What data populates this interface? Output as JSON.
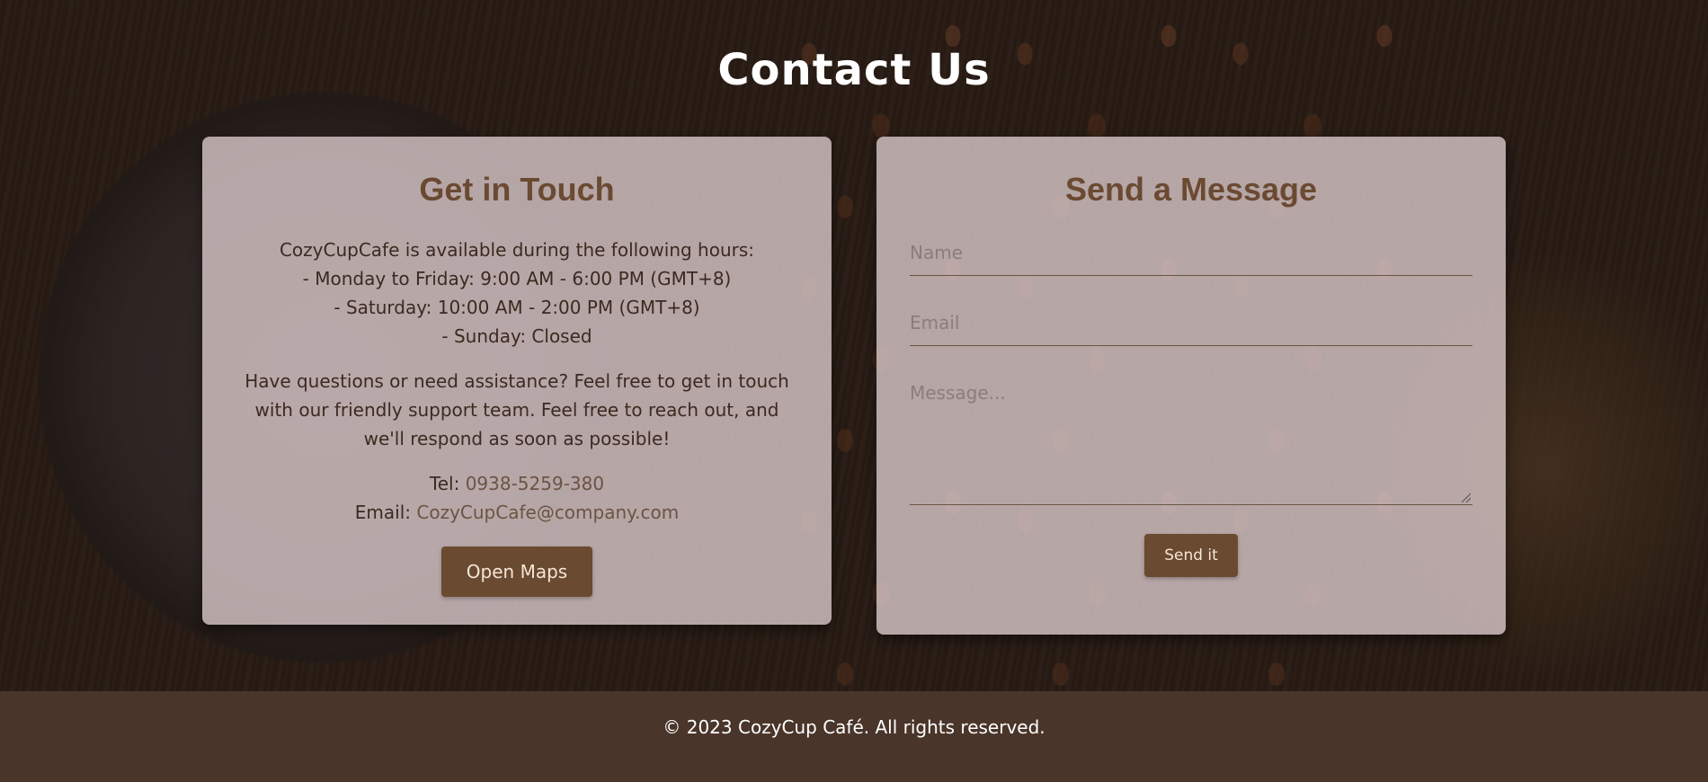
{
  "page_title": "Contact Us",
  "get_in_touch": {
    "heading": "Get in Touch",
    "hours_intro": "CozyCupCafe is available during the following hours:",
    "hours": [
      "- Monday to Friday: 9:00 AM - 6:00 PM (GMT+8)",
      "- Saturday: 10:00 AM - 2:00 PM (GMT+8)",
      "- Sunday: Closed"
    ],
    "about": "Have questions or need assistance? Feel free to get in touch with our friendly support team. Feel free to reach out, and we'll respond as soon as possible!",
    "tel_label": "Tel: ",
    "tel_value": "0938-5259-380",
    "email_label": "Email: ",
    "email_value": "CozyCupCafe@company.com",
    "maps_button": "Open Maps"
  },
  "send_message": {
    "heading": "Send a Message",
    "name_placeholder": "Name",
    "email_placeholder": "Email",
    "message_placeholder": "Message...",
    "send_button": "Send it"
  },
  "footer": {
    "copyright": "© 2023 CozyCup Café. All rights reserved."
  },
  "colors": {
    "accent": "#6b4a32",
    "footer_bg": "#4a352a",
    "card_bg": "#d6c4c6"
  }
}
